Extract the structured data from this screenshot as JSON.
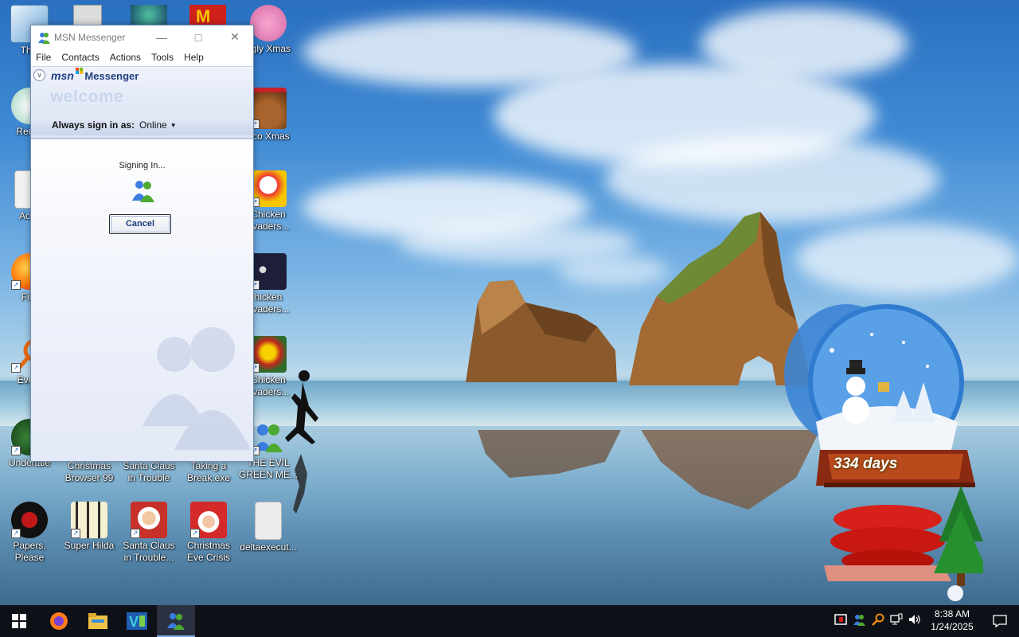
{
  "desktop": {
    "icons": [
      {
        "label": "This"
      },
      {
        "label": "Recyc"
      },
      {
        "label": "Activ"
      },
      {
        "label": "Fire"
      },
      {
        "label": "Every"
      },
      {
        "label": "Undertale"
      },
      {
        "label": "Christmas Browser 99"
      },
      {
        "label": "Santa Claus in Trouble"
      },
      {
        "label": "Taking a Break.exe"
      },
      {
        "label": "THE EVIL GREEN ME..."
      },
      {
        "label": "Papers, Please"
      },
      {
        "label": "Super Hilda"
      },
      {
        "label": "Santa Claus in Trouble..."
      },
      {
        "label": "Christmas Eve Crisis"
      },
      {
        "label": "deltaexecut..."
      },
      {
        "label": "ggly Xmas"
      },
      {
        "label": "oco Xmas"
      },
      {
        "label": "Chicken nvaders..."
      },
      {
        "label": "hicken nvaders..."
      },
      {
        "label": "Chicken nvaders..."
      }
    ]
  },
  "msn": {
    "title": "MSN Messenger",
    "menu": [
      "File",
      "Contacts",
      "Actions",
      "Tools",
      "Help"
    ],
    "brand_msn": "msn",
    "brand_messenger": "Messenger",
    "welcome": "welcome",
    "always_sign_in_label": "Always sign in as:",
    "status_value": "Online",
    "signing_in": "Signing In...",
    "cancel_label": "Cancel"
  },
  "widget": {
    "days_text": "334 days"
  },
  "taskbar": {
    "time": "8:38 AM",
    "date": "1/24/2025"
  }
}
